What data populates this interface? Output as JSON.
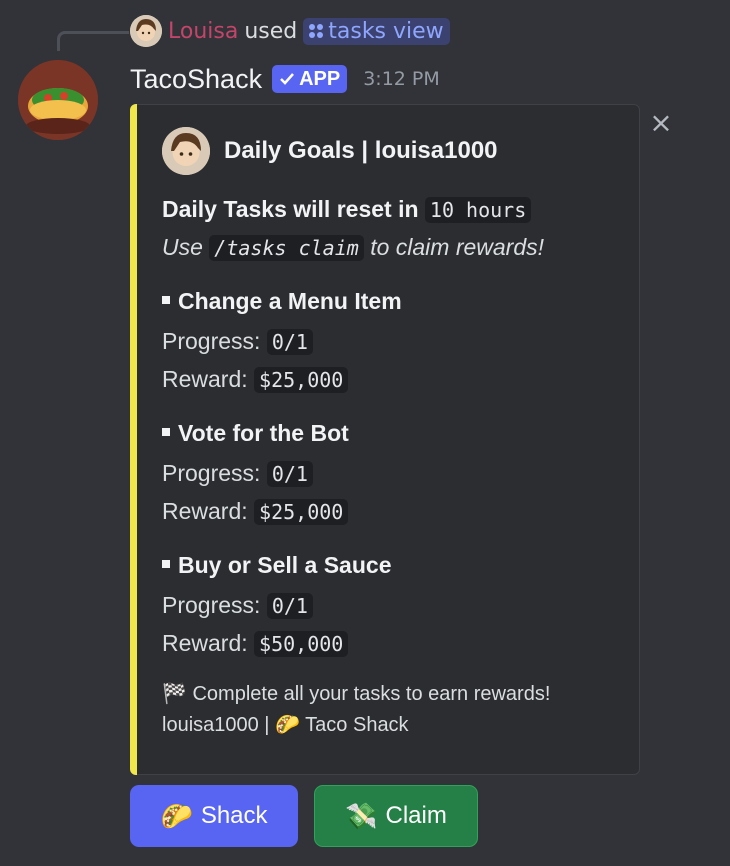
{
  "reply": {
    "user": "Louisa",
    "used": "used",
    "command": "tasks view"
  },
  "message": {
    "bot_name": "TacoShack",
    "badge": "APP",
    "timestamp": "3:12 PM"
  },
  "embed": {
    "accent_color": "#f0e84a",
    "author": "Daily Goals | louisa1000",
    "reset_prefix": "Daily Tasks will reset in",
    "reset_value": "10 hours",
    "claim_prefix": "Use",
    "claim_command": "/tasks claim",
    "claim_suffix": "to claim rewards!",
    "tasks": [
      {
        "title": "Change a Menu Item",
        "progress_label": "Progress:",
        "progress": "0/1",
        "reward_label": "Reward:",
        "reward": "$25,000"
      },
      {
        "title": "Vote for the Bot",
        "progress_label": "Progress:",
        "progress": "0/1",
        "reward_label": "Reward:",
        "reward": "$25,000"
      },
      {
        "title": "Buy or Sell a Sauce",
        "progress_label": "Progress:",
        "progress": "0/1",
        "reward_label": "Reward:",
        "reward": "$50,000"
      }
    ],
    "footer_line1": "Complete all your tasks to earn rewards!",
    "footer_line2_user": "louisa1000 |",
    "footer_line2_name": "Taco Shack"
  },
  "buttons": {
    "shack_label": "Shack",
    "claim_label": "Claim",
    "shack_color": "#5865f2",
    "claim_color": "#248046"
  },
  "icons": [
    "taco-icon",
    "money-icon",
    "checkered-flag-icon",
    "close-icon",
    "check-icon",
    "app-command-icon"
  ]
}
